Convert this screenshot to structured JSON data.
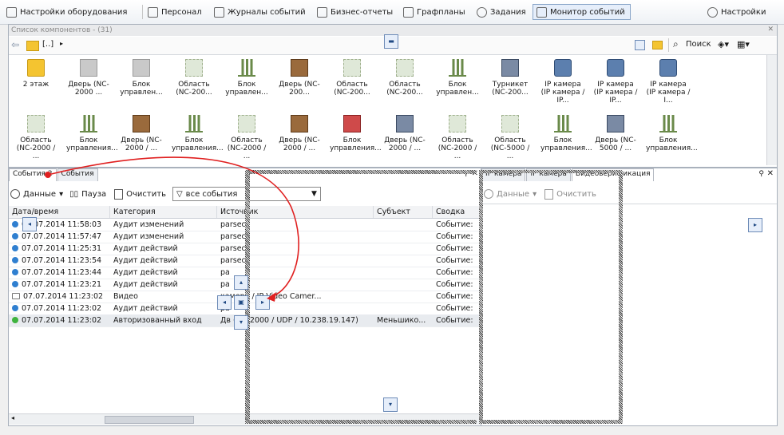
{
  "topbar": {
    "items": [
      {
        "label": "Настройки оборудования",
        "icon": "hardware-settings-icon"
      },
      {
        "label": "Персонал",
        "icon": "personnel-icon"
      },
      {
        "label": "Журналы событий",
        "icon": "event-logs-icon"
      },
      {
        "label": "Бизнес-отчеты",
        "icon": "reports-icon"
      },
      {
        "label": "Графпланы",
        "icon": "floorplans-icon"
      },
      {
        "label": "Задания",
        "icon": "tasks-icon"
      },
      {
        "label": "Монитор событий",
        "icon": "monitor-icon"
      }
    ],
    "settings_label": "Настройки"
  },
  "complist": {
    "title": "Список компонентов - (31)",
    "path": "[..]",
    "search_label": "Поиск",
    "row1": [
      {
        "label": "2 этаж",
        "icon": "folder"
      },
      {
        "label": "Дверь (NC-2000 ...",
        "icon": "door-gray"
      },
      {
        "label": "Блок управлен...",
        "icon": "block-gray"
      },
      {
        "label": "Область (NC-200...",
        "icon": "area-gray"
      },
      {
        "label": "Блок управлен...",
        "icon": "block"
      },
      {
        "label": "Дверь (NC-200...",
        "icon": "door"
      },
      {
        "label": "Область (NC-200...",
        "icon": "area"
      },
      {
        "label": "Область (NC-200...",
        "icon": "area"
      },
      {
        "label": "Блок управлен...",
        "icon": "block"
      },
      {
        "label": "Турникет (NC-200...",
        "icon": "turnstile"
      },
      {
        "label": "IP камера (IP камера / IP...",
        "icon": "camera"
      },
      {
        "label": "IP камера (IP камера / IP...",
        "icon": "camera"
      },
      {
        "label": "IP камера (IP камера / I...",
        "icon": "camera"
      }
    ],
    "row2": [
      {
        "label": "Область (NC-2000 / ...",
        "icon": "area"
      },
      {
        "label": "Блок управления...",
        "icon": "block"
      },
      {
        "label": "Дверь (NC-2000 / ...",
        "icon": "door"
      },
      {
        "label": "Блок управления...",
        "icon": "block"
      },
      {
        "label": "Область (NC-2000 / ...",
        "icon": "area-gray"
      },
      {
        "label": "Дверь (NC-2000 / ...",
        "icon": "door"
      },
      {
        "label": "Блок управления...",
        "icon": "block-red"
      },
      {
        "label": "Дверь (NC-2000 / ...",
        "icon": "turnstile"
      },
      {
        "label": "Область (NC-2000 / ...",
        "icon": "area-gray"
      },
      {
        "label": "Область (NC-5000 / ...",
        "icon": "area"
      },
      {
        "label": "Блок управления...",
        "icon": "block"
      },
      {
        "label": "Дверь (NC-5000 / ...",
        "icon": "turnstile"
      },
      {
        "label": "Блок управления...",
        "icon": "block"
      }
    ]
  },
  "events": {
    "tabs": [
      "События 2",
      "События"
    ],
    "toolbar": {
      "data_label": "Данные",
      "pause_label": "Пауза",
      "clear_label": "Очистить",
      "filter_value": "все события"
    },
    "columns": [
      "Дата/время",
      "Категория",
      "Источник",
      "Субъект",
      "Сводка"
    ],
    "rows": [
      {
        "time": "07.07.2014 11:58:03",
        "category": "Аудит изменений",
        "source": "parsec",
        "subject": "",
        "summary": "Событие:",
        "dot": "blue"
      },
      {
        "time": "07.07.2014 11:57:47",
        "category": "Аудит изменений",
        "source": "parsec",
        "subject": "",
        "summary": "Событие:",
        "dot": "blue"
      },
      {
        "time": "07.07.2014 11:25:31",
        "category": "Аудит действий",
        "source": "parsec",
        "subject": "",
        "summary": "Событие:",
        "dot": "blue"
      },
      {
        "time": "07.07.2014 11:23:54",
        "category": "Аудит действий",
        "source": "parsec",
        "subject": "",
        "summary": "Событие:",
        "dot": "blue"
      },
      {
        "time": "07.07.2014 11:23:44",
        "category": "Аудит действий",
        "source": "pa",
        "subject": "",
        "summary": "Событие:",
        "dot": "blue"
      },
      {
        "time": "07.07.2014 11:23:21",
        "category": "Аудит действий",
        "source": "pa",
        "subject": "",
        "summary": "Событие:",
        "dot": "blue"
      },
      {
        "time": "07.07.2014 11:23:02",
        "category": "Видео",
        "source": "камера / IP Video Camer...",
        "subject": "",
        "summary": "Событие:",
        "dot": "video"
      },
      {
        "time": "07.07.2014 11:23:02",
        "category": "Аудит действий",
        "source": "pa",
        "subject": "",
        "summary": "Событие:",
        "dot": "blue"
      },
      {
        "time": "07.07.2014 11:23:02",
        "category": "Авторизованный вход",
        "source": "Дв (NC-2000 / UDP / 10.238.19.147)",
        "subject": "Меньшико...",
        "summary": "Событие:",
        "dot": "green"
      }
    ]
  },
  "video": {
    "tabs": [
      "IP камера",
      "IP камера",
      "Видеоверификация"
    ],
    "data_label": "Данные",
    "clear_label": "Очистить"
  }
}
